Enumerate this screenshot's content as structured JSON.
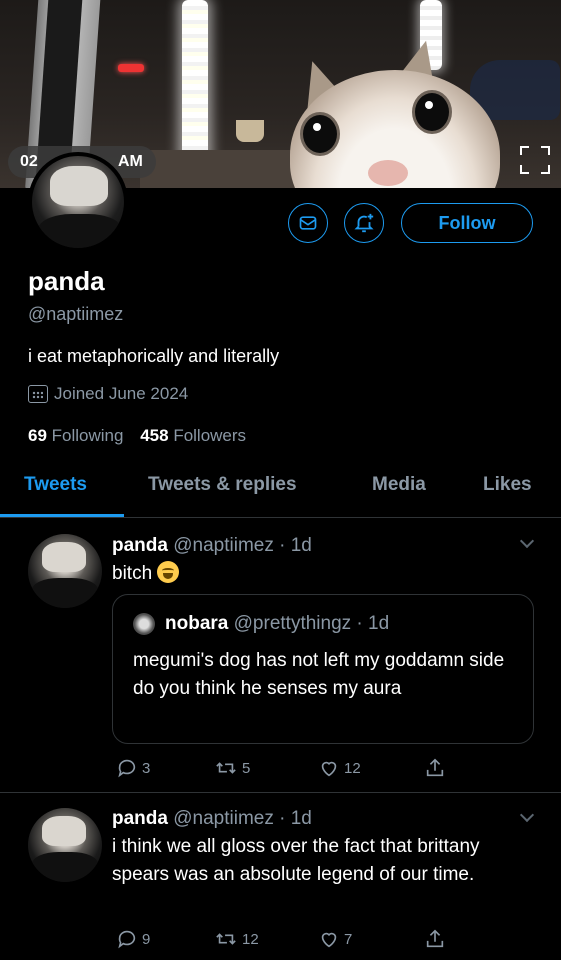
{
  "banner": {
    "timestamp_prefix": "02",
    "timestamp_suffix": "AM"
  },
  "profile": {
    "name": "panda",
    "handle": "@naptiimez",
    "bio": "i eat metaphorically and literally",
    "joined": "Joined June 2024",
    "following_count": "69",
    "following_label": "Following",
    "followers_count": "458",
    "followers_label": "Followers",
    "follow_label": "Follow"
  },
  "tabs": [
    "Tweets",
    "Tweets & replies",
    "Media",
    "Likes"
  ],
  "tweets": [
    {
      "name": "panda",
      "handle_time": "@naptiimez · 1d",
      "text": "bitch",
      "quote": {
        "name": "nobara",
        "handle_time": "@prettythingz · 1d",
        "text": "megumi's dog has not left my goddamn side do you think he senses my aura"
      },
      "replies": "3",
      "retweets": "5",
      "likes": "12"
    },
    {
      "name": "panda",
      "handle_time": "@naptiimez · 1d",
      "text": "i think we all gloss over the fact that brittany spears was an absolute legend of our time.",
      "replies": "9",
      "retweets": "12",
      "likes": "7"
    }
  ],
  "colors": {
    "accent": "#1d9bf0",
    "muted": "#8b98a5",
    "background": "#000000",
    "border": "#2f3336"
  }
}
